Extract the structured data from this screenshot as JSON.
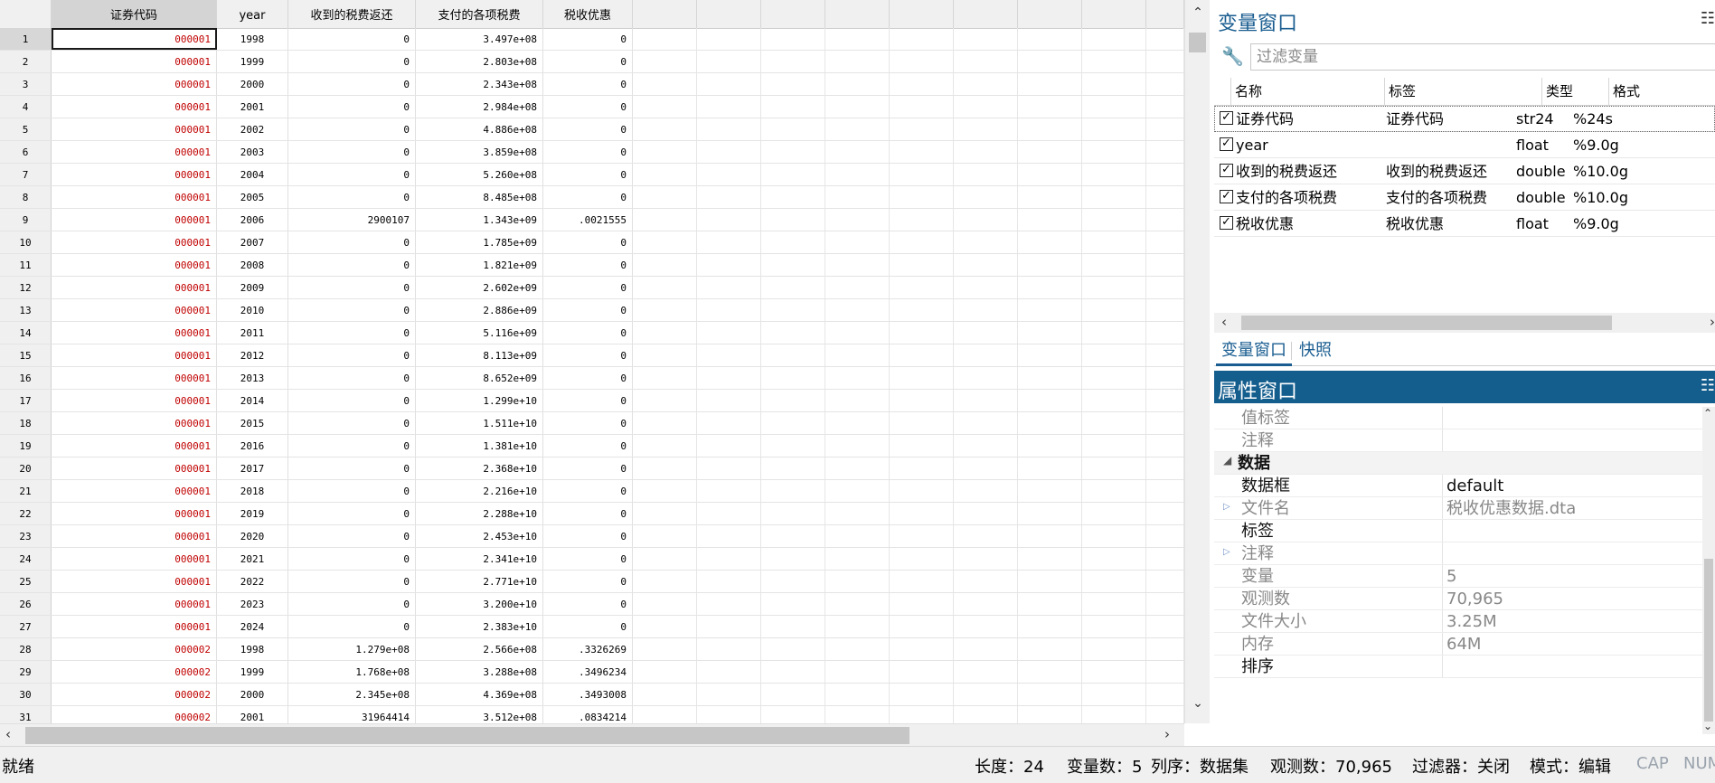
{
  "grid": {
    "columns": [
      "证券代码",
      "year",
      "收到的税费返还",
      "支付的各项税费",
      "税收优惠"
    ],
    "rows": [
      {
        "n": "1",
        "code": "000001",
        "year": "1998",
        "refund": "0",
        "paid": "3.497e+08",
        "pref": "0"
      },
      {
        "n": "2",
        "code": "000001",
        "year": "1999",
        "refund": "0",
        "paid": "2.803e+08",
        "pref": "0"
      },
      {
        "n": "3",
        "code": "000001",
        "year": "2000",
        "refund": "0",
        "paid": "2.343e+08",
        "pref": "0"
      },
      {
        "n": "4",
        "code": "000001",
        "year": "2001",
        "refund": "0",
        "paid": "2.984e+08",
        "pref": "0"
      },
      {
        "n": "5",
        "code": "000001",
        "year": "2002",
        "refund": "0",
        "paid": "4.886e+08",
        "pref": "0"
      },
      {
        "n": "6",
        "code": "000001",
        "year": "2003",
        "refund": "0",
        "paid": "3.859e+08",
        "pref": "0"
      },
      {
        "n": "7",
        "code": "000001",
        "year": "2004",
        "refund": "0",
        "paid": "5.260e+08",
        "pref": "0"
      },
      {
        "n": "8",
        "code": "000001",
        "year": "2005",
        "refund": "0",
        "paid": "8.485e+08",
        "pref": "0"
      },
      {
        "n": "9",
        "code": "000001",
        "year": "2006",
        "refund": "2900107",
        "paid": "1.343e+09",
        "pref": ".0021555"
      },
      {
        "n": "10",
        "code": "000001",
        "year": "2007",
        "refund": "0",
        "paid": "1.785e+09",
        "pref": "0"
      },
      {
        "n": "11",
        "code": "000001",
        "year": "2008",
        "refund": "0",
        "paid": "1.821e+09",
        "pref": "0"
      },
      {
        "n": "12",
        "code": "000001",
        "year": "2009",
        "refund": "0",
        "paid": "2.602e+09",
        "pref": "0"
      },
      {
        "n": "13",
        "code": "000001",
        "year": "2010",
        "refund": "0",
        "paid": "2.886e+09",
        "pref": "0"
      },
      {
        "n": "14",
        "code": "000001",
        "year": "2011",
        "refund": "0",
        "paid": "5.116e+09",
        "pref": "0"
      },
      {
        "n": "15",
        "code": "000001",
        "year": "2012",
        "refund": "0",
        "paid": "8.113e+09",
        "pref": "0"
      },
      {
        "n": "16",
        "code": "000001",
        "year": "2013",
        "refund": "0",
        "paid": "8.652e+09",
        "pref": "0"
      },
      {
        "n": "17",
        "code": "000001",
        "year": "2014",
        "refund": "0",
        "paid": "1.299e+10",
        "pref": "0"
      },
      {
        "n": "18",
        "code": "000001",
        "year": "2015",
        "refund": "0",
        "paid": "1.511e+10",
        "pref": "0"
      },
      {
        "n": "19",
        "code": "000001",
        "year": "2016",
        "refund": "0",
        "paid": "1.381e+10",
        "pref": "0"
      },
      {
        "n": "20",
        "code": "000001",
        "year": "2017",
        "refund": "0",
        "paid": "2.368e+10",
        "pref": "0"
      },
      {
        "n": "21",
        "code": "000001",
        "year": "2018",
        "refund": "0",
        "paid": "2.216e+10",
        "pref": "0"
      },
      {
        "n": "22",
        "code": "000001",
        "year": "2019",
        "refund": "0",
        "paid": "2.288e+10",
        "pref": "0"
      },
      {
        "n": "23",
        "code": "000001",
        "year": "2020",
        "refund": "0",
        "paid": "2.453e+10",
        "pref": "0"
      },
      {
        "n": "24",
        "code": "000001",
        "year": "2021",
        "refund": "0",
        "paid": "2.341e+10",
        "pref": "0"
      },
      {
        "n": "25",
        "code": "000001",
        "year": "2022",
        "refund": "0",
        "paid": "2.771e+10",
        "pref": "0"
      },
      {
        "n": "26",
        "code": "000001",
        "year": "2023",
        "refund": "0",
        "paid": "3.200e+10",
        "pref": "0"
      },
      {
        "n": "27",
        "code": "000001",
        "year": "2024",
        "refund": "0",
        "paid": "2.383e+10",
        "pref": "0"
      },
      {
        "n": "28",
        "code": "000002",
        "year": "1998",
        "refund": "1.279e+08",
        "paid": "2.566e+08",
        "pref": ".3326269"
      },
      {
        "n": "29",
        "code": "000002",
        "year": "1999",
        "refund": "1.768e+08",
        "paid": "3.288e+08",
        "pref": ".3496234"
      },
      {
        "n": "30",
        "code": "000002",
        "year": "2000",
        "refund": "2.345e+08",
        "paid": "4.369e+08",
        "pref": ".3493008"
      },
      {
        "n": "31",
        "code": "000002",
        "year": "2001",
        "refund": "31964414",
        "paid": "3.512e+08",
        "pref": ".0834214"
      }
    ]
  },
  "variables_window": {
    "title": "变量窗口",
    "filter_placeholder": "过滤变量",
    "headers": {
      "name": "名称",
      "label": "标签",
      "type": "类型",
      "format": "格式"
    },
    "variables": [
      {
        "name": "证券代码",
        "label": "证券代码",
        "type": "str24",
        "format": "%24s"
      },
      {
        "name": "year",
        "label": "",
        "type": "float",
        "format": "%9.0g"
      },
      {
        "name": "收到的税费返还",
        "label": "收到的税费返还",
        "type": "double",
        "format": "%10.0g"
      },
      {
        "name": "支付的各项税费",
        "label": "支付的各项税费",
        "type": "double",
        "format": "%10.0g"
      },
      {
        "name": "税收优惠",
        "label": "税收优惠",
        "type": "float",
        "format": "%9.0g"
      }
    ],
    "tabs": [
      "变量窗口",
      "快照"
    ]
  },
  "properties_window": {
    "title": "属性窗口",
    "rows": [
      {
        "key": "值标签",
        "value": ""
      },
      {
        "key": "注释",
        "value": ""
      },
      {
        "key": "数据",
        "value": ""
      },
      {
        "key": "数据框",
        "value": "default"
      },
      {
        "key": "文件名",
        "value": "税收优惠数据.dta"
      },
      {
        "key": "标签",
        "value": ""
      },
      {
        "key": "注释",
        "value": ""
      },
      {
        "key": "变量",
        "value": "5"
      },
      {
        "key": "观测数",
        "value": "70,965"
      },
      {
        "key": "文件大小",
        "value": "3.25M"
      },
      {
        "key": "内存",
        "value": "64M"
      },
      {
        "key": "排序",
        "value": ""
      }
    ]
  },
  "status_bar": {
    "ready": "就绪",
    "length": "长度：24",
    "var_count": "变量数：5",
    "order": "列序：数据集",
    "obs_count": "观测数：70,965",
    "filter": "过滤器：关闭",
    "mode": "模式：编辑",
    "cap": "CAP",
    "num": "NUM"
  }
}
